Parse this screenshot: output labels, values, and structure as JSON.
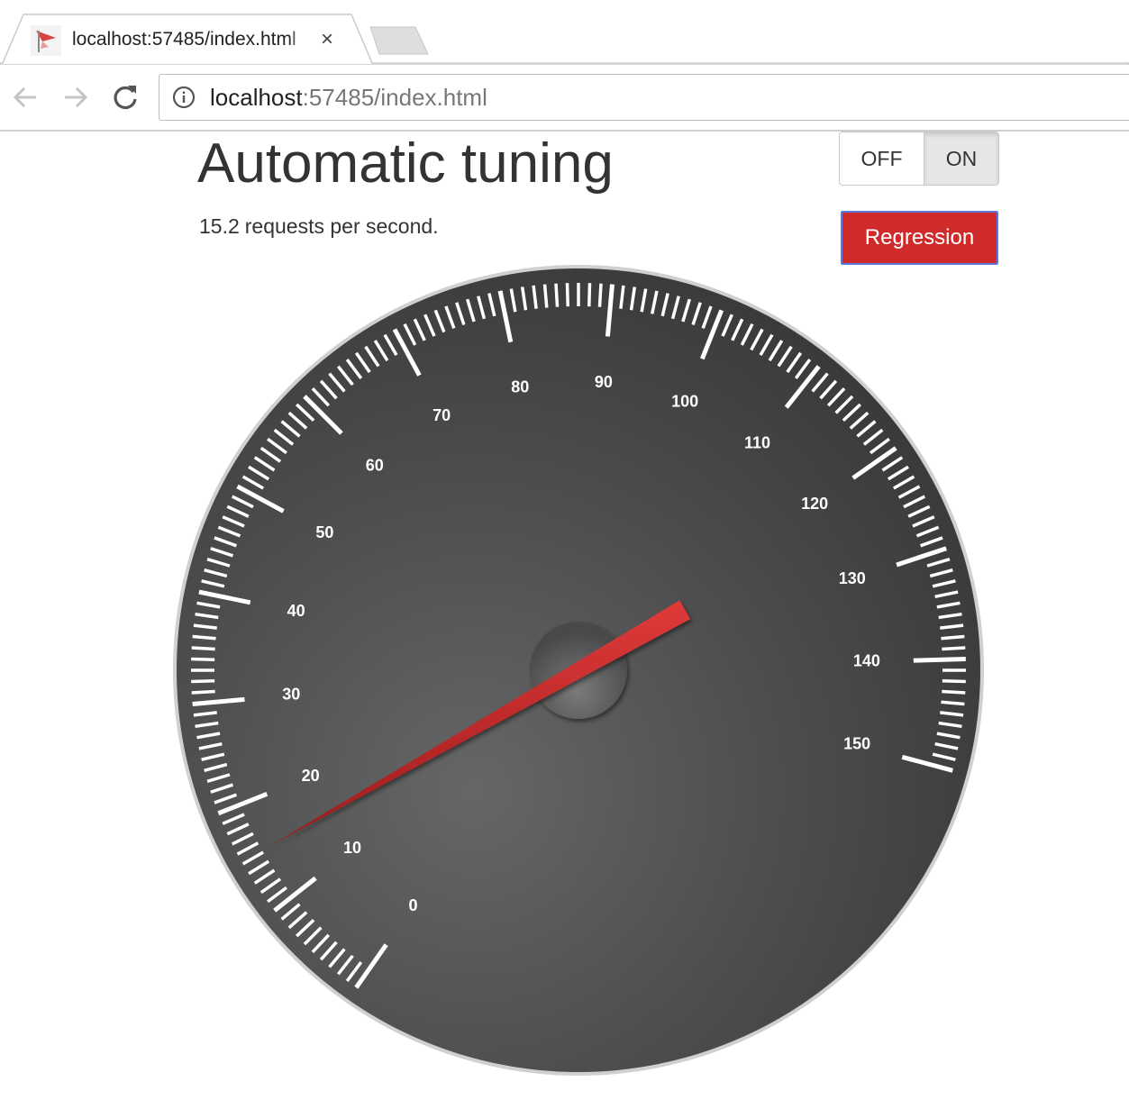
{
  "browser": {
    "tab_title": "localhost:57485/index.html",
    "tab_close": "×",
    "url_host": "localhost",
    "url_rest": ":57485/index.html"
  },
  "page": {
    "title": "Automatic tuning",
    "rate_value": "15.2",
    "rate_unit": "requests per second.",
    "toggle_off": "OFF",
    "toggle_on": "ON",
    "toggle_selected": "ON",
    "regression_label": "Regression"
  },
  "chart_data": {
    "type": "gauge",
    "min": 0,
    "max": 150,
    "value": 15.2,
    "major_ticks": [
      0,
      10,
      20,
      30,
      40,
      50,
      60,
      70,
      80,
      90,
      100,
      110,
      120,
      130,
      140,
      150
    ],
    "tick_labels": [
      "0",
      "10",
      "20",
      "30",
      "40",
      "50",
      "60",
      "70",
      "80",
      "90",
      "100",
      "110",
      "120",
      "130",
      "140",
      "150"
    ],
    "minor_ticks_per_major": 10,
    "colors": {
      "dial": "#444444",
      "needle": "#c62828",
      "ticks": "#ffffff",
      "rim": "#cccccc"
    }
  },
  "colors": {
    "regression_bg": "#cf2b2b",
    "regression_border": "#5b78e0",
    "toggle_active_bg": "#e6e6e6"
  }
}
